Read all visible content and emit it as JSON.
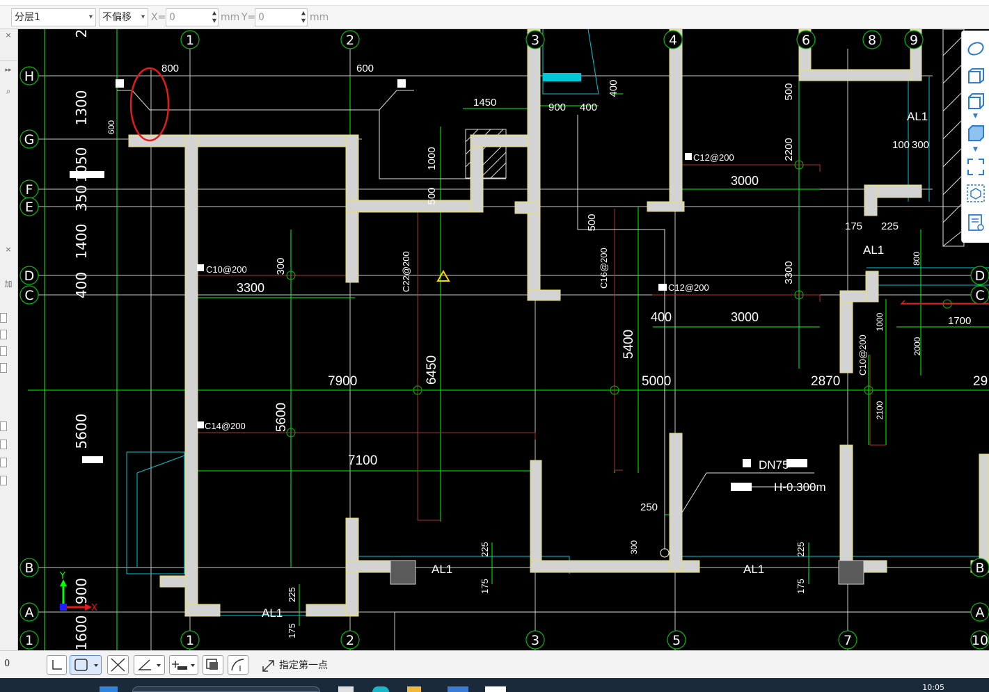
{
  "toolbar": {
    "layer_select": "分层1",
    "offset_select": "不偏移",
    "x_label": "X=",
    "x_value": "0",
    "x_unit": "mm",
    "y_label": "Y=",
    "y_value": "0",
    "y_unit": "mm"
  },
  "left_panel": {
    "close1": "×",
    "expand": "▸▸",
    "close2": "×",
    "item": "加"
  },
  "canvas": {
    "axis_top": [
      "2",
      "1",
      "2",
      "3",
      "4",
      "6",
      "8",
      "9"
    ],
    "axis_bottom": [
      "1",
      "1",
      "2",
      "3",
      "5",
      "7",
      "10"
    ],
    "axis_left": [
      "H",
      "G",
      "F",
      "E",
      "D",
      "C",
      "B",
      "A"
    ],
    "axis_right": [
      "D",
      "C",
      "B",
      "A"
    ],
    "left_dims": [
      "1300",
      "1050",
      "350",
      "1400",
      "400",
      "5600",
      "900",
      "1600"
    ],
    "dims": {
      "d800": "800",
      "d600a": "600",
      "d600b": "600",
      "d1450": "1450",
      "d900": "900",
      "d400a": "400",
      "d400b": "400",
      "d1000a": "1000",
      "d500a": "500",
      "d500b": "500",
      "d500c": "500",
      "d2200": "2200",
      "d3000a": "3000",
      "d3000b": "3000",
      "d100": "100",
      "d300a": "300",
      "d175a": "175",
      "d225a": "225",
      "d800b": "800",
      "d300b": "300",
      "d3300a": "3300",
      "d3300b": "3300",
      "d7900": "7900",
      "d6450": "6450",
      "d5400": "5400",
      "d5000": "5000",
      "d2870": "2870",
      "d29": "29",
      "d400c": "400",
      "d1000b": "1000",
      "d1700": "1700",
      "d2000": "2000",
      "d2100": "2100",
      "d5600": "5600",
      "d7100": "7100",
      "d250": "250",
      "d300c": "300",
      "d225b": "225",
      "d175b": "175",
      "d225c": "225",
      "d175c": "175",
      "d225d": "225",
      "d175d": "175"
    },
    "labels": {
      "al1_a": "AL1",
      "al1_b": "AL1",
      "al1_c": "AL1",
      "al1_d": "AL1",
      "al1_e": "AL1",
      "pipe": "DN75",
      "elev": "H-0.300m",
      "rebar_c10": "C10@200",
      "rebar_c14": "C14@200",
      "rebar_c12a": "C12@200",
      "rebar_c12b": "C12@200",
      "rebar_c16": "C16@200",
      "rebar_c22": "C22@200",
      "rebar_c10b": "C10@200"
    },
    "ucs_x": "X",
    "ucs_y": "Y"
  },
  "statusbar": {
    "left_value": "0",
    "prompt": "指定第一点"
  },
  "taskbar": {
    "clock": "10:05"
  },
  "colors": {
    "canvas_bg": "#000000",
    "grid_green": "#00ff00",
    "wall_fill": "#d3d3d3",
    "wall_edge": "#ffff00",
    "cyan": "#00c8d8",
    "marker_red": "#e41b1b",
    "dark_red": "#b03030"
  }
}
